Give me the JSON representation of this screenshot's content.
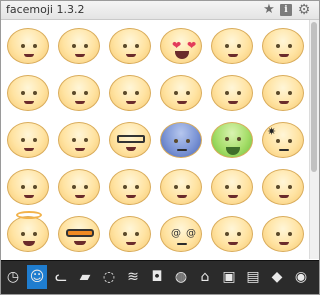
{
  "app": {
    "title": "facemoji 1.3.2"
  },
  "toolbar": {
    "favorite_icon": "star-icon",
    "info_label": "i",
    "settings_icon": "gear-icon"
  },
  "emojis": [
    "smile",
    "grin",
    "big-grin",
    "heart-eyes",
    "sweat-smile",
    "nervous",
    "sleepy",
    "crying",
    "shocked",
    "flat",
    "star-eyes",
    "grimace",
    "pleased",
    "teeth-grin",
    "glasses",
    "cold-blue",
    "sick-green",
    "angry",
    "neutral",
    "cute",
    "ha",
    "wink",
    "happy",
    "mischief",
    "angel",
    "sunglasses",
    "sad",
    "dizzy",
    "expressionless",
    "smirk"
  ],
  "bottom_tabs": [
    {
      "name": "recent",
      "icon": "clock-icon"
    },
    {
      "name": "faces",
      "icon": "smile-face-icon",
      "active": true
    },
    {
      "name": "animals-1",
      "icon": "cat-face-icon"
    },
    {
      "name": "animals-2",
      "icon": "bird-icon"
    },
    {
      "name": "animals-3",
      "icon": "ghost-icon"
    },
    {
      "name": "animals-4",
      "icon": "crab-icon"
    },
    {
      "name": "objects-1",
      "icon": "cup-icon"
    },
    {
      "name": "objects-2",
      "icon": "alarm-icon"
    },
    {
      "name": "objects-3",
      "icon": "house-icon"
    },
    {
      "name": "objects-4",
      "icon": "robot-icon"
    },
    {
      "name": "objects-5",
      "icon": "monitor-icon"
    },
    {
      "name": "objects-6",
      "icon": "cat-icon"
    },
    {
      "name": "objects-7",
      "icon": "bear-icon"
    }
  ]
}
